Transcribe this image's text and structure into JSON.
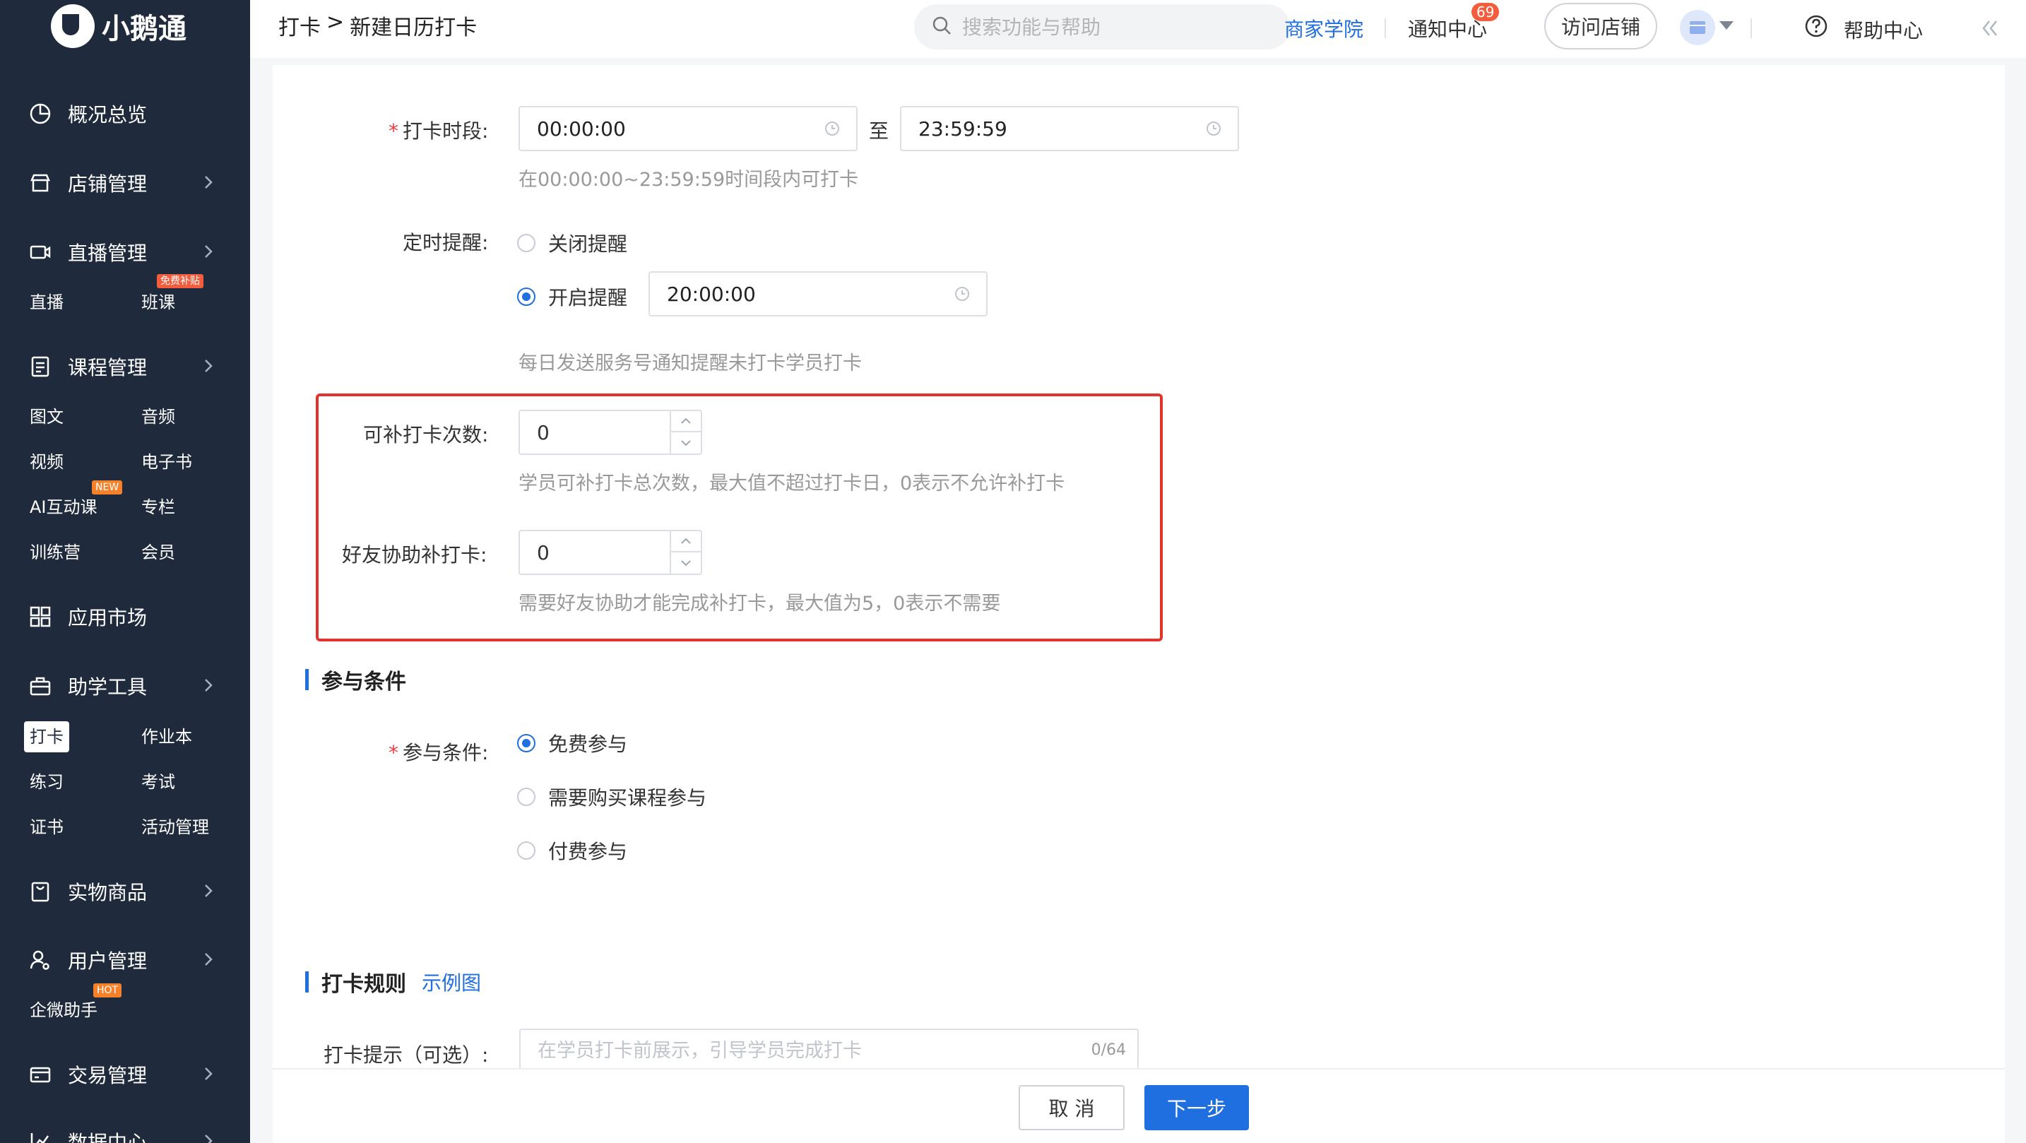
{
  "brand": {
    "name": "小鹅通",
    "accent": "#1f6fe0",
    "sidebar_bg": "#1f2a3d",
    "highlight": "#e2322b"
  },
  "sidebar": {
    "items": [
      {
        "label": "概况总览",
        "icon": "pie-chart-icon"
      },
      {
        "label": "店铺管理",
        "icon": "store-icon"
      },
      {
        "label": "直播管理",
        "icon": "video-camera-icon"
      },
      {
        "label": "课程管理",
        "icon": "document-icon"
      },
      {
        "label": "应用市场",
        "icon": "grid-apps-icon"
      },
      {
        "label": "助学工具",
        "icon": "toolbox-icon"
      },
      {
        "label": "实物商品",
        "icon": "shopping-bag-icon"
      },
      {
        "label": "用户管理",
        "icon": "user-gear-icon"
      },
      {
        "label": "交易管理",
        "icon": "wallet-icon"
      },
      {
        "label": "数据中心",
        "icon": "chart-icon"
      }
    ],
    "sub": {
      "live": [
        "直播",
        "班课"
      ],
      "live_badge": "免费补贴",
      "course": [
        "图文",
        "音频",
        "视频",
        "电子书",
        "AI互动课",
        "专栏",
        "训练营",
        "会员"
      ],
      "course_badge": "NEW",
      "tools": [
        "打卡",
        "作业本",
        "练习",
        "考试",
        "证书",
        "活动管理"
      ],
      "user": [
        "企微助手"
      ],
      "user_badge": "HOT"
    }
  },
  "header": {
    "breadcrumb": [
      "打卡",
      ">",
      "新建日历打卡"
    ],
    "search_placeholder": "搜索功能与帮助",
    "academy": "商家学院",
    "notify": "通知中心",
    "notify_count": "69",
    "visit_store": "访问店铺",
    "help": "帮助中心"
  },
  "form": {
    "period_label": "打卡时段:",
    "time_start": "00:00:00",
    "time_to": "至",
    "time_end": "23:59:59",
    "period_hint": "在00:00:00~23:59:59时间段内可打卡",
    "reminder_label": "定时提醒:",
    "reminder_off": "关闭提醒",
    "reminder_on": "开启提醒",
    "reminder_time": "20:00:00",
    "reminder_hint": "每日发送服务号通知提醒未打卡学员打卡",
    "makeup_label": "可补打卡次数:",
    "makeup_value": "0",
    "makeup_hint": "学员可补打卡总次数，最大值不超过打卡日，0表示不允许补打卡",
    "friend_label": "好友协助补打卡:",
    "friend_value": "0",
    "friend_hint": "需要好友协助才能完成补打卡，最大值为5，0表示不需要",
    "join_section": "参与条件",
    "join_label": "参与条件:",
    "join_options": [
      "免费参与",
      "需要购买课程参与",
      "付费参与"
    ],
    "rules_section": "打卡规则",
    "rules_example": "示例图",
    "tip_label": "打卡提示（可选）:",
    "tip_placeholder": "在学员打卡前展示，引导学员完成打卡",
    "tip_counter": "0/64"
  },
  "footer": {
    "cancel": "取 消",
    "next": "下一步"
  }
}
